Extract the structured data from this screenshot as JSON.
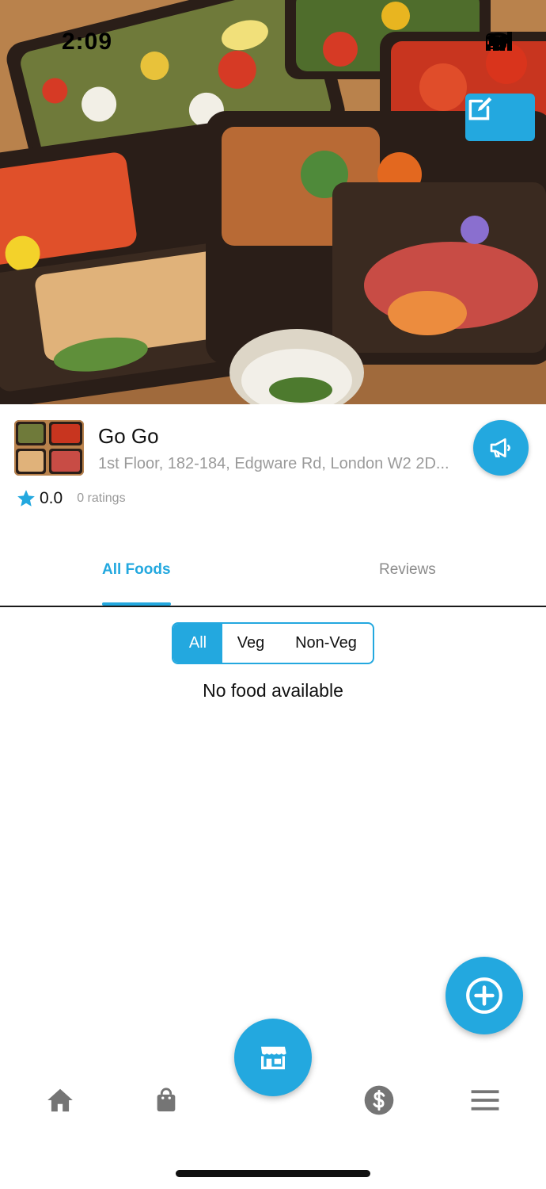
{
  "status_bar": {
    "time": "2:09"
  },
  "store": {
    "name": "Go Go",
    "address": "1st Floor, 182-184, Edgware Rd, London W2 2D...",
    "rating": "0.0",
    "ratings_count": "0 ratings"
  },
  "tabs": [
    {
      "label": "All Foods",
      "active": true
    },
    {
      "label": "Reviews",
      "active": false
    }
  ],
  "filters": [
    {
      "label": "All",
      "active": true
    },
    {
      "label": "Veg",
      "active": false
    },
    {
      "label": "Non-Veg",
      "active": false
    }
  ],
  "empty_message": "No food available",
  "bottom_nav": [
    "home-icon",
    "shopping-bag-icon",
    "store-icon",
    "dollar-icon",
    "menu-icon"
  ],
  "colors": {
    "accent": "#23a8df",
    "muted": "#9a9a9a"
  }
}
